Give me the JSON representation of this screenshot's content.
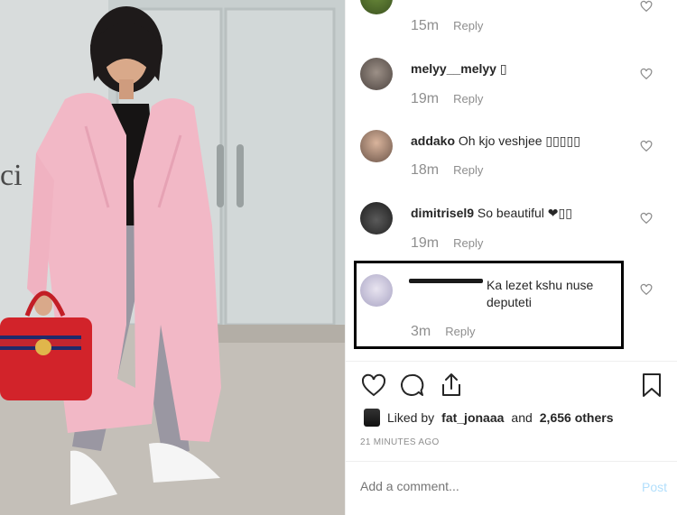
{
  "comments": [
    {
      "username": "",
      "text": "",
      "time": "15m",
      "reply": "Reply"
    },
    {
      "username": "melyy__melyy",
      "text": "▯",
      "time": "19m",
      "reply": "Reply"
    },
    {
      "username": "addako",
      "text": "Oh kjo veshjee ▯▯▯▯▯",
      "time": "18m",
      "reply": "Reply"
    },
    {
      "username": "dimitrisel9",
      "text": "So beautiful ❤︎▯▯",
      "time": "19m",
      "reply": "Reply"
    },
    {
      "username": "",
      "text": "Ka lezet kshu nuse deputeti",
      "time": "3m",
      "reply": "Reply"
    }
  ],
  "likes": {
    "prefix": "Liked by",
    "user": "fat_jonaaa",
    "joiner": "and",
    "count": "2,656 others"
  },
  "posted_ago": "21 MINUTES AGO",
  "add_comment": {
    "placeholder": "Add a comment...",
    "post_label": "Post"
  },
  "colors": {
    "accent_disabled": "#b2dffc",
    "muted": "#8e8e8e",
    "coat": "#f2b8c6",
    "bag": "#d2232a"
  }
}
